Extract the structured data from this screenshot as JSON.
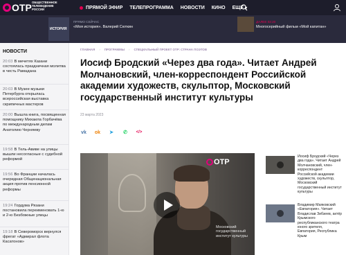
{
  "brand": {
    "logo_text": "ОТР",
    "subtitle": "ОБЩЕСТВЕННОЕ ТЕЛЕВИДЕНИЕ РОССИИ",
    "accent": "#e4007c"
  },
  "nav": {
    "items": [
      {
        "label": "ПРЯМОЙ ЭФИР"
      },
      {
        "label": "ТЕЛЕПРОГРАММА"
      },
      {
        "label": "НОВОСТИ"
      },
      {
        "label": "КИНО"
      },
      {
        "label": "ЕЩЕ"
      }
    ],
    "search_icon": "search-icon",
    "user_icon": "user-icon"
  },
  "schedule": {
    "now_label": "Прямо сейчас",
    "now_title": "«Моя история». Валерий Сюткин",
    "thumb_text": "ИСТОРИЯ",
    "next_time": "Далее 02:20",
    "next_title": "Многосерийный фильм «Мой капитан»"
  },
  "news": {
    "heading": "НОВОСТИ",
    "items": [
      {
        "time": "20:03",
        "text": "В мечетях Казани состоялась праздничная молитва в честь Рамадана"
      },
      {
        "time": "20:03",
        "text": "В Музее музыки Петербурга открылась всероссийская выставка скрипичных мастеров"
      },
      {
        "time": "20:00",
        "text": "Вышла книга, посвященная помощнику Михаила Горбачёва по международным делам Анатолию Черняеву"
      },
      {
        "time": "19:58",
        "text": "В Тель-Авиве на улицы вышли несогласные с судебной реформой"
      },
      {
        "time": "19:56",
        "text": "Во Франции началась очередная Общенациональная акция против пенсионной реформы"
      },
      {
        "time": "19:24",
        "text": "Гордума Рязани постановила переименовать 1-ю и 2-ю Безбожные улицы"
      },
      {
        "time": "19:18",
        "text": "В Североморск вернулся фрегат «Адмирал флота Касатонов»"
      }
    ]
  },
  "article": {
    "breadcrumbs": [
      "ГЛАВНАЯ",
      "ПРОГРАММЫ",
      "СПЕЦИАЛЬНЫЙ ПРОЕКТ ОТР: СТРАНА ПОЭТОВ"
    ],
    "title": "Иосиф Бродский «Через два года». Читает Андрей Молчановский, член-корреспондент Российской академии художеств, скульптор, Московский государственный институт культуры",
    "date": "23 марта 2023",
    "share": [
      {
        "icon": "vk-icon",
        "glyph": "vk",
        "color": "#4a76a8"
      },
      {
        "icon": "odnoklassniki-icon",
        "glyph": "ok",
        "color": "#ee8208"
      },
      {
        "icon": "telegram-icon",
        "glyph": "➤",
        "color": "#2aa3df"
      },
      {
        "icon": "whatsapp-icon",
        "glyph": "✆",
        "color": "#25d366"
      },
      {
        "icon": "embed-icon",
        "glyph": "</>",
        "color": "#e4004f"
      }
    ],
    "video": {
      "logo_text": "ОТР",
      "caption": "Московский государственный институт культуры"
    }
  },
  "related": [
    {
      "text": "Иосиф Бродский «Через два года». Читает Андрей Молчановский, член-корреспондент Российской академии художеств, скульптор, Московский государственный институт культуры"
    },
    {
      "text": "Владимир Маяковский «Евпатория». Читает Владислав Зибзеев, актёр Крымского республиканского театра юного зрителя, Евпатория, Республика Крым"
    }
  ]
}
